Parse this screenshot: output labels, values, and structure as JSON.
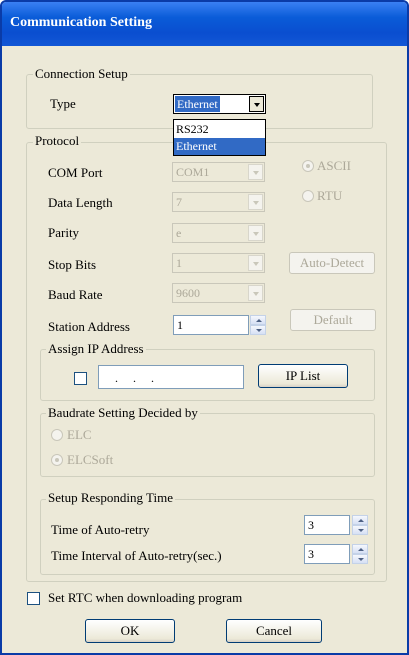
{
  "window": {
    "title": "Communication Setting"
  },
  "connection": {
    "legend": "Connection Setup",
    "type_label": "Type",
    "type_value": "Ethernet",
    "type_options": [
      "RS232",
      "Ethernet"
    ]
  },
  "protocol": {
    "legend": "Protocol",
    "com_port_label": "COM Port",
    "com_port_value": "COM1",
    "data_length_label": "Data Length",
    "data_length_value": "7",
    "parity_label": "Parity",
    "parity_value": "e",
    "stop_bits_label": "Stop Bits",
    "stop_bits_value": "1",
    "baud_rate_label": "Baud Rate",
    "baud_rate_value": "9600",
    "station_address_label": "Station Address",
    "station_address_value": "1",
    "ascii_label": "ASCII",
    "rtu_label": "RTU",
    "auto_detect_label": "Auto-Detect",
    "default_label": "Default"
  },
  "assign_ip": {
    "legend": "Assign IP Address",
    "ip_value": ". . .",
    "ip_list_label": "IP List"
  },
  "baudrate_decided": {
    "legend": "Baudrate Setting Decided by",
    "elc_label": "ELC",
    "elcsoft_label": "ELCSoft"
  },
  "responding_time": {
    "legend": "Setup Responding Time",
    "auto_retry_label": "Time of Auto-retry",
    "auto_retry_value": "3",
    "interval_label": "Time Interval of Auto-retry(sec.)",
    "interval_value": "3"
  },
  "rtc_label": "Set RTC when downloading program",
  "buttons": {
    "ok": "OK",
    "cancel": "Cancel"
  }
}
